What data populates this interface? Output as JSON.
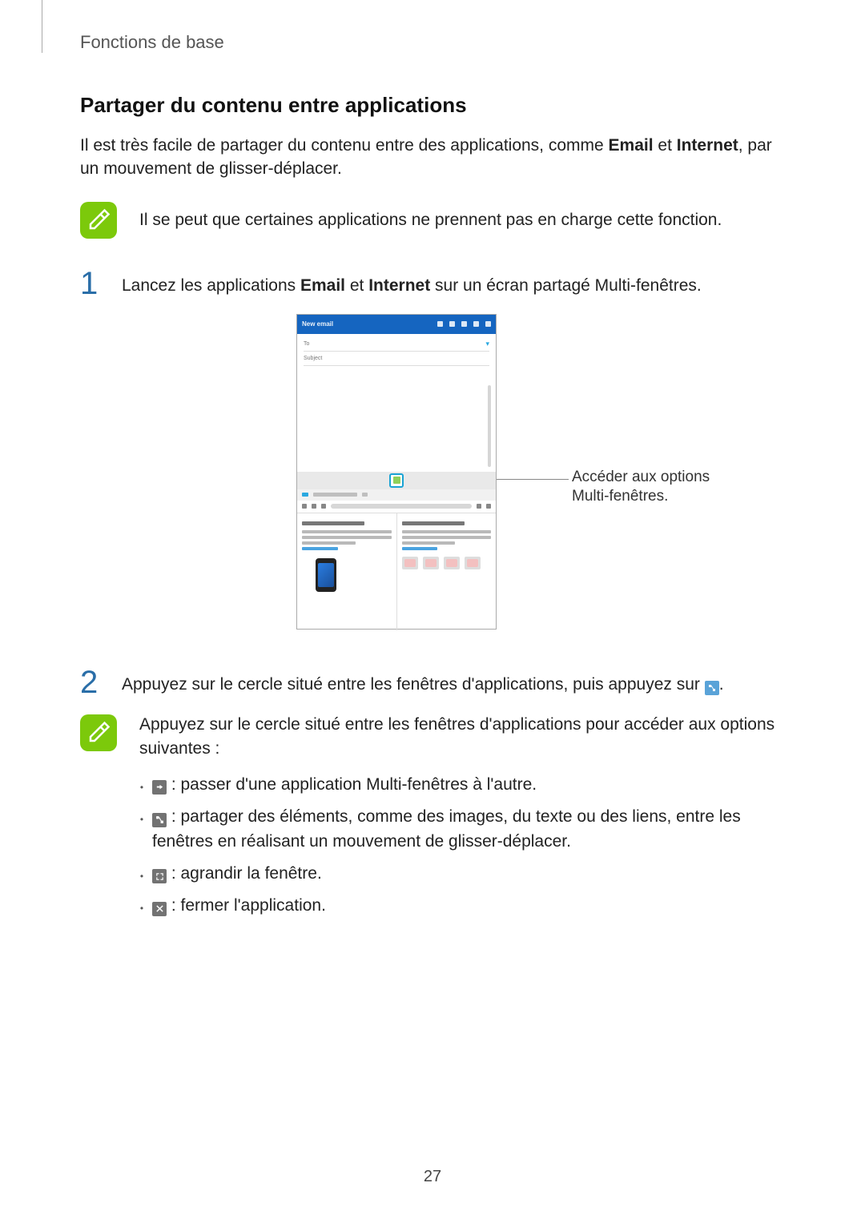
{
  "header": {
    "breadcrumb": "Fonctions de base"
  },
  "section": {
    "title": "Partager du contenu entre applications",
    "intro_pre": "Il est très facile de partager du contenu entre des applications, comme ",
    "intro_b1": "Email",
    "intro_mid": " et ",
    "intro_b2": "Internet",
    "intro_post": ", par un mouvement de glisser-déplacer."
  },
  "note1": {
    "text": "Il se peut que certaines applications ne prennent pas en charge cette fonction."
  },
  "steps": {
    "s1": {
      "num": "1",
      "pre": "Lancez les applications ",
      "b1": "Email",
      "mid": " et ",
      "b2": "Internet",
      "post": " sur un écran partagé Multi-fenêtres."
    },
    "s2": {
      "num": "2",
      "pre": "Appuyez sur le cercle situé entre les fenêtres d'applications, puis appuyez sur ",
      "post": "."
    }
  },
  "figure": {
    "email_title": "New email",
    "to_label": "To",
    "subject_label": "Subject",
    "callout": "Accéder aux options Multi-fenêtres."
  },
  "note2": {
    "lead": "Appuyez sur le cercle situé entre les fenêtres d'applications pour accéder aux options suivantes :",
    "items": {
      "i1": " : passer d'une application Multi-fenêtres à l'autre.",
      "i2": " : partager des éléments, comme des images, du texte ou des liens, entre les fenêtres en réalisant un mouvement de glisser-déplacer.",
      "i3": " : agrandir la fenêtre.",
      "i4": " : fermer l'application."
    }
  },
  "pageNumber": "27"
}
